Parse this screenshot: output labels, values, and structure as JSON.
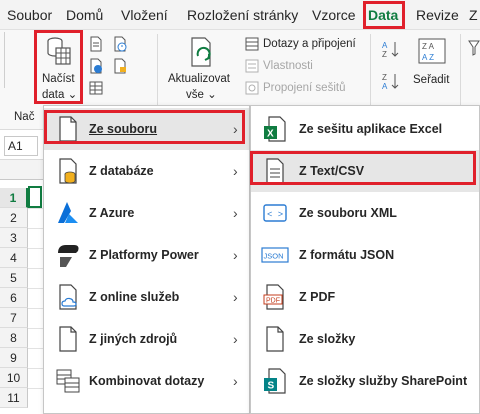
{
  "menubar": {
    "tabs": [
      "Soubor",
      "Domů",
      "Vložení",
      "Rozložení stránky",
      "Vzorce",
      "Data",
      "Revize",
      "Z"
    ],
    "active": "Data"
  },
  "ribbon": {
    "get_data": {
      "line1": "Načíst",
      "line2": "data",
      "caret": "⌄"
    },
    "group_label_partial": "Nač",
    "refresh": {
      "line1": "Aktualizovat",
      "line2": "vše",
      "caret": "⌄"
    },
    "queries": [
      {
        "label": "Dotazy a připojení",
        "enabled": true
      },
      {
        "label": "Vlastnosti",
        "enabled": false
      },
      {
        "label": "Propojení sešitů",
        "enabled": false
      }
    ],
    "sort_label": "Seřadit"
  },
  "formula_bar": {
    "name_box": "A1"
  },
  "grid": {
    "rows": [
      "1",
      "2",
      "3",
      "4",
      "5",
      "6",
      "7",
      "8",
      "9",
      "10",
      "11"
    ]
  },
  "menu_primary": {
    "items": [
      {
        "label": "Ze souboru",
        "icon": "file-icon",
        "arrow": "›"
      },
      {
        "label": "Z databáze",
        "icon": "database-icon",
        "arrow": "›"
      },
      {
        "label": "Z Azure",
        "icon": "azure-icon",
        "arrow": "›"
      },
      {
        "label": "Z Platformy Power",
        "icon": "power-platform-icon",
        "arrow": "›"
      },
      {
        "label": "Z online služeb",
        "icon": "cloud-file-icon",
        "arrow": "›"
      },
      {
        "label": "Z jiných zdrojů",
        "icon": "other-sources-icon",
        "arrow": "›"
      },
      {
        "label": "Kombinovat dotazy",
        "icon": "combine-queries-icon",
        "arrow": "›"
      }
    ]
  },
  "menu_secondary": {
    "items": [
      {
        "label": "Ze sešitu aplikace Excel",
        "icon": "excel-file-icon"
      },
      {
        "label": "Z Text/CSV",
        "icon": "text-file-icon"
      },
      {
        "label": "Ze souboru XML",
        "icon": "xml-icon"
      },
      {
        "label": "Z formátu JSON",
        "icon": "json-icon"
      },
      {
        "label": "Z PDF",
        "icon": "pdf-icon"
      },
      {
        "label": "Ze složky",
        "icon": "folder-icon"
      },
      {
        "label": "Ze složky služby SharePoint",
        "icon": "sharepoint-folder-icon"
      }
    ]
  },
  "icon_text": {
    "json": "JSON",
    "pdf": "PDF",
    "xml": "< >",
    "excel": "X",
    "sharepoint": "S"
  },
  "colors": {
    "highlight": "#e0202b",
    "excel_green": "#107c41",
    "azure_blue": "#0a6fd8",
    "database_yellow": "#f2b01e"
  }
}
